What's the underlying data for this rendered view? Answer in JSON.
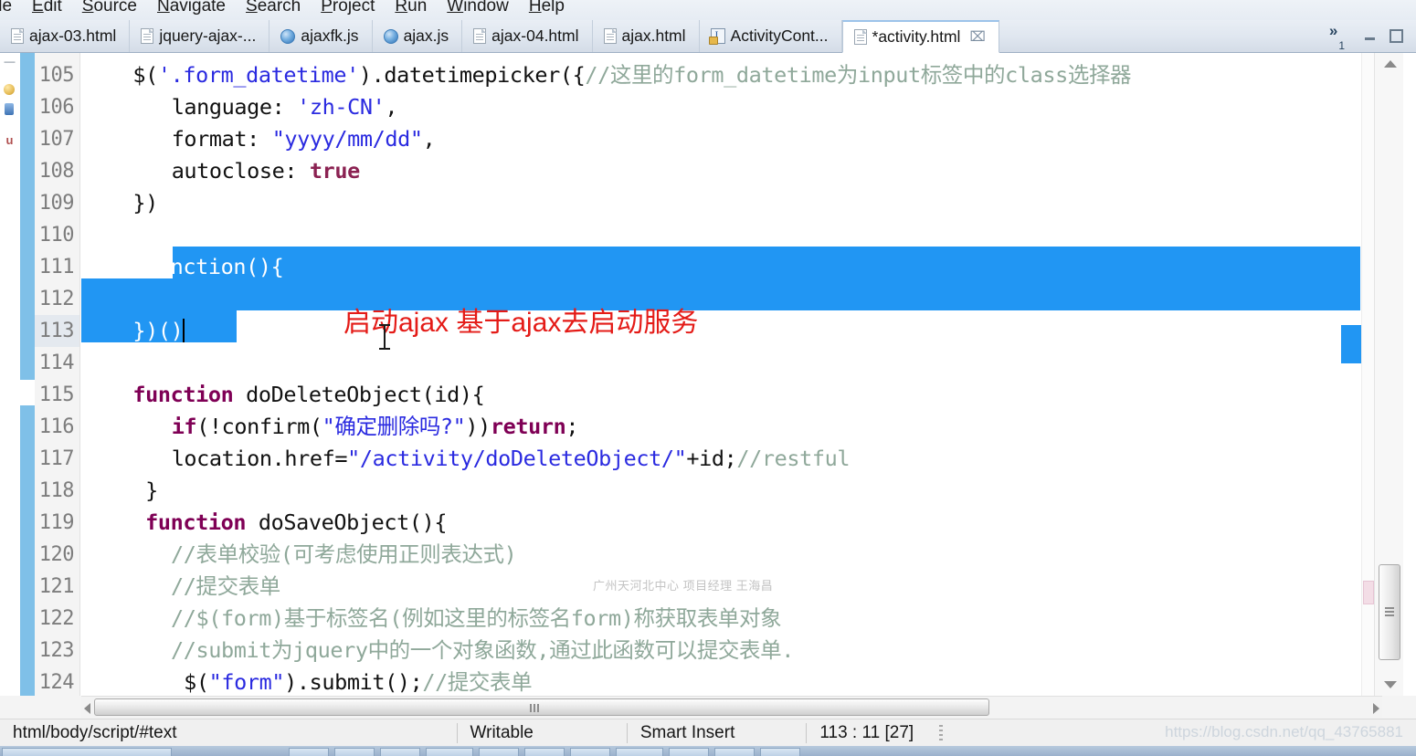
{
  "menu": {
    "items": [
      {
        "label": "ile",
        "mnemonic_index": -1
      },
      {
        "label": "Edit"
      },
      {
        "label": "Source"
      },
      {
        "label": "Navigate"
      },
      {
        "label": "Search"
      },
      {
        "label": "Project"
      },
      {
        "label": "Run"
      },
      {
        "label": "Window"
      },
      {
        "label": "Help"
      }
    ]
  },
  "tabs": {
    "items": [
      {
        "label": "ajax-03.html",
        "icon": "html-file-icon",
        "active": false,
        "dirty": false
      },
      {
        "label": "jquery-ajax-...",
        "icon": "html-file-icon",
        "active": false,
        "dirty": false
      },
      {
        "label": "ajaxfk.js",
        "icon": "js-file-icon",
        "active": false,
        "dirty": false
      },
      {
        "label": "ajax.js",
        "icon": "js-file-icon",
        "active": false,
        "dirty": false
      },
      {
        "label": "ajax-04.html",
        "icon": "html-file-icon",
        "active": false,
        "dirty": false
      },
      {
        "label": "ajax.html",
        "icon": "html-file-icon",
        "active": false,
        "dirty": false
      },
      {
        "label": "ActivityCont...",
        "icon": "java-file-icon",
        "active": false,
        "dirty": false
      },
      {
        "label": "*activity.html",
        "icon": "html-file-icon",
        "active": true,
        "dirty": true,
        "close_glyph": "⌧"
      }
    ],
    "overflow_chevron": "»",
    "overflow_count": "1"
  },
  "editor": {
    "first_line": 105,
    "current_line_number": 113,
    "lines": [
      {
        "n": "105",
        "indent": 4,
        "segments": [
          {
            "t": "$(",
            "c": "plain"
          },
          {
            "t": "'.form_datetime'",
            "c": "str"
          },
          {
            "t": ").datetimepicker({",
            "c": "plain"
          },
          {
            "t": "//这里的form_datetime为input标签中的class选择器",
            "c": "com"
          }
        ]
      },
      {
        "n": "106",
        "indent": 7,
        "segments": [
          {
            "t": "language: ",
            "c": "plain"
          },
          {
            "t": "'zh-CN'",
            "c": "str"
          },
          {
            "t": ",",
            "c": "plain"
          }
        ]
      },
      {
        "n": "107",
        "indent": 7,
        "segments": [
          {
            "t": "format: ",
            "c": "plain"
          },
          {
            "t": "\"yyyy/mm/dd\"",
            "c": "str"
          },
          {
            "t": ",",
            "c": "plain"
          }
        ]
      },
      {
        "n": "108",
        "indent": 7,
        "segments": [
          {
            "t": "autoclose: ",
            "c": "plain"
          },
          {
            "t": "true",
            "c": "kw2"
          }
        ]
      },
      {
        "n": "109",
        "indent": 4,
        "segments": [
          {
            "t": "})",
            "c": "plain"
          }
        ]
      },
      {
        "n": "110",
        "indent": 0,
        "segments": []
      },
      {
        "n": "111",
        "indent": 4,
        "selected": true,
        "segments": [
          {
            "t": "(function(){",
            "c": "white"
          }
        ]
      },
      {
        "n": "112",
        "indent": 0,
        "selected": true,
        "segments": []
      },
      {
        "n": "113",
        "indent": 4,
        "selected": true,
        "caret": true,
        "segments": [
          {
            "t": "})()",
            "c": "white"
          }
        ]
      },
      {
        "n": "114",
        "indent": 0,
        "segments": []
      },
      {
        "n": "115",
        "indent": 4,
        "segments": [
          {
            "t": "function",
            "c": "kw"
          },
          {
            "t": " doDeleteObject(id){",
            "c": "plain"
          }
        ]
      },
      {
        "n": "116",
        "indent": 7,
        "segments": [
          {
            "t": "if",
            "c": "kw"
          },
          {
            "t": "(!confirm(",
            "c": "plain"
          },
          {
            "t": "\"确定删除吗?\"",
            "c": "str"
          },
          {
            "t": "))",
            "c": "plain"
          },
          {
            "t": "return",
            "c": "kw"
          },
          {
            "t": ";",
            "c": "plain"
          }
        ]
      },
      {
        "n": "117",
        "indent": 7,
        "segments": [
          {
            "t": "location.href=",
            "c": "plain"
          },
          {
            "t": "\"/activity/doDeleteObject/\"",
            "c": "str"
          },
          {
            "t": "+id;",
            "c": "plain"
          },
          {
            "t": "//restful",
            "c": "com"
          }
        ]
      },
      {
        "n": "118",
        "indent": 4,
        "segments": [
          {
            "t": " }",
            "c": "plain"
          }
        ]
      },
      {
        "n": "119",
        "indent": 4,
        "segments": [
          {
            "t": " ",
            "c": "plain"
          },
          {
            "t": "function",
            "c": "kw"
          },
          {
            "t": " doSaveObject(){",
            "c": "plain"
          }
        ]
      },
      {
        "n": "120",
        "indent": 5,
        "segments": [
          {
            "t": "  //表单校验(可考虑使用正则表达式)",
            "c": "com"
          }
        ]
      },
      {
        "n": "121",
        "indent": 5,
        "segments": [
          {
            "t": "  //提交表单",
            "c": "com"
          }
        ]
      },
      {
        "n": "122",
        "indent": 5,
        "segments": [
          {
            "t": "  //$(form)基于标签名(例如这里的标签名form)称获取表单对象",
            "c": "com"
          }
        ]
      },
      {
        "n": "123",
        "indent": 5,
        "segments": [
          {
            "t": "  //submit为jquery中的一个对象函数,通过此函数可以提交表单.",
            "c": "com"
          }
        ]
      },
      {
        "n": "124",
        "indent": 6,
        "segments": [
          {
            "t": "  $(",
            "c": "plain"
          },
          {
            "t": "\"form\"",
            "c": "str"
          },
          {
            "t": ").submit();",
            "c": "plain"
          },
          {
            "t": "//提交表单",
            "c": "com"
          }
        ]
      }
    ],
    "annotation": "启动ajax 基于ajax去启动服务",
    "inline_watermark": "广州天河北中心 项目经理 王海昌"
  },
  "statusbar": {
    "path": "html/body/script/#text",
    "writable": "Writable",
    "insert_mode": "Smart Insert",
    "position": "113 : 11 [27]",
    "watermark": "https://blog.csdn.net/qq_43765881"
  },
  "colors": {
    "selection_blue": "#2196f3",
    "annotation_red": "#e41b17",
    "comment_green": "#8fa89a",
    "string_blue": "#2a2ae0",
    "keyword_purple": "#7f0055",
    "changebar_blue": "#7fc0e8"
  }
}
